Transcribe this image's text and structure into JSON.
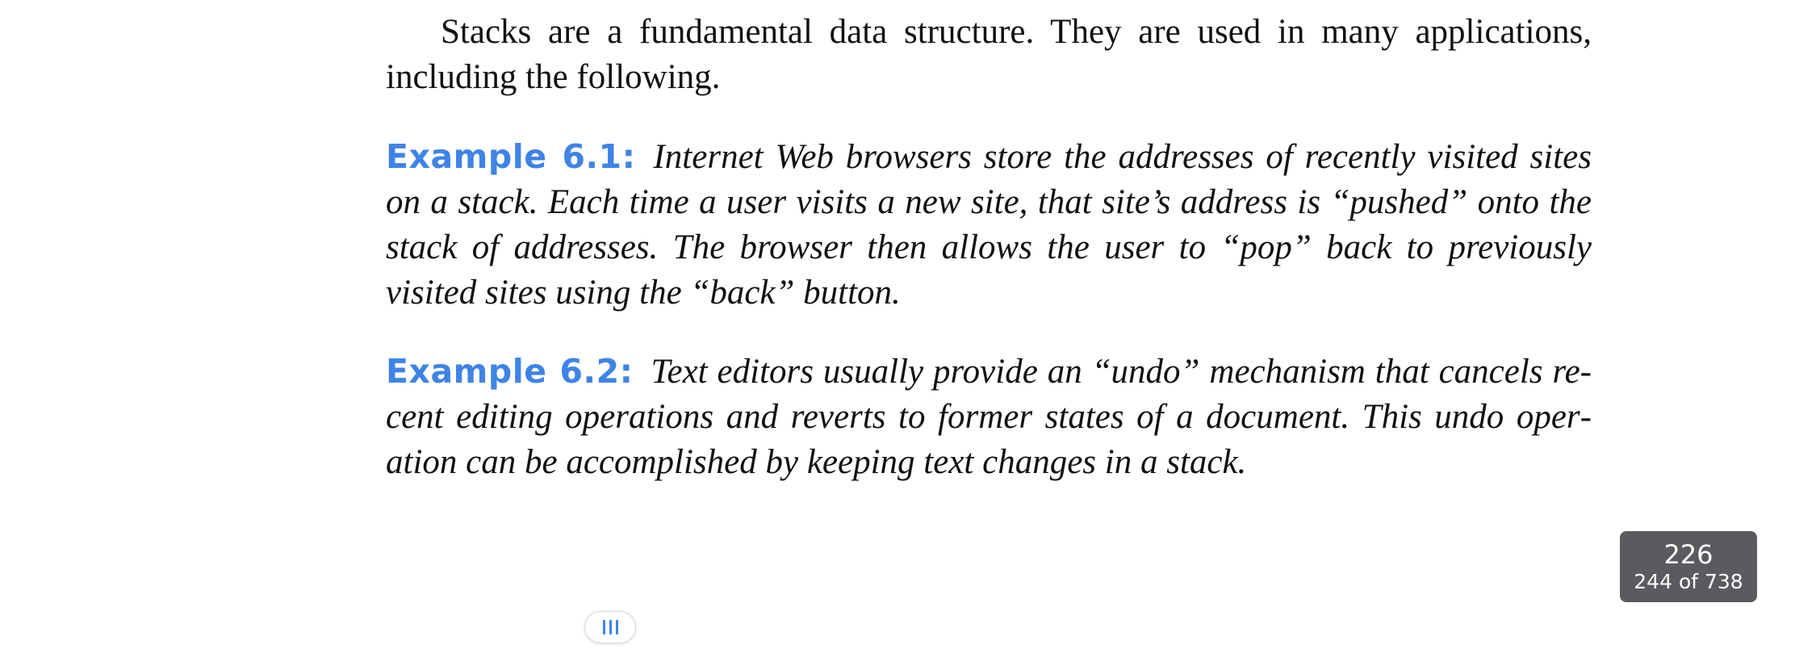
{
  "page": {
    "intro": "Stacks are a fundamental data structure. They are used in many applications, including the following.",
    "examples": [
      {
        "label": "Example 6.1:",
        "text": "Internet Web browsers store the addresses of recently visited sites on a stack. Each time a user visits a new site, that site’s address is “pushed” onto the stack of addresses. The browser then allows the user to “pop” back to previously visited sites using the “back” button."
      },
      {
        "label": "Example 6.2:",
        "text": "Text editors usually provide an “undo” mechanism that cancels re­cent editing operations and reverts to former states of a document. This undo oper­ation can be accomplished by keeping text changes in a stack."
      }
    ]
  },
  "page_indicator": {
    "page_number": "226",
    "position_text": "244 of 738"
  },
  "scrubber": {
    "icon": "grip-lines-icon",
    "accent_color": "#3f83e6"
  },
  "colors": {
    "example_label": "#3f83e6",
    "indicator_background": "#5b5b5f"
  }
}
